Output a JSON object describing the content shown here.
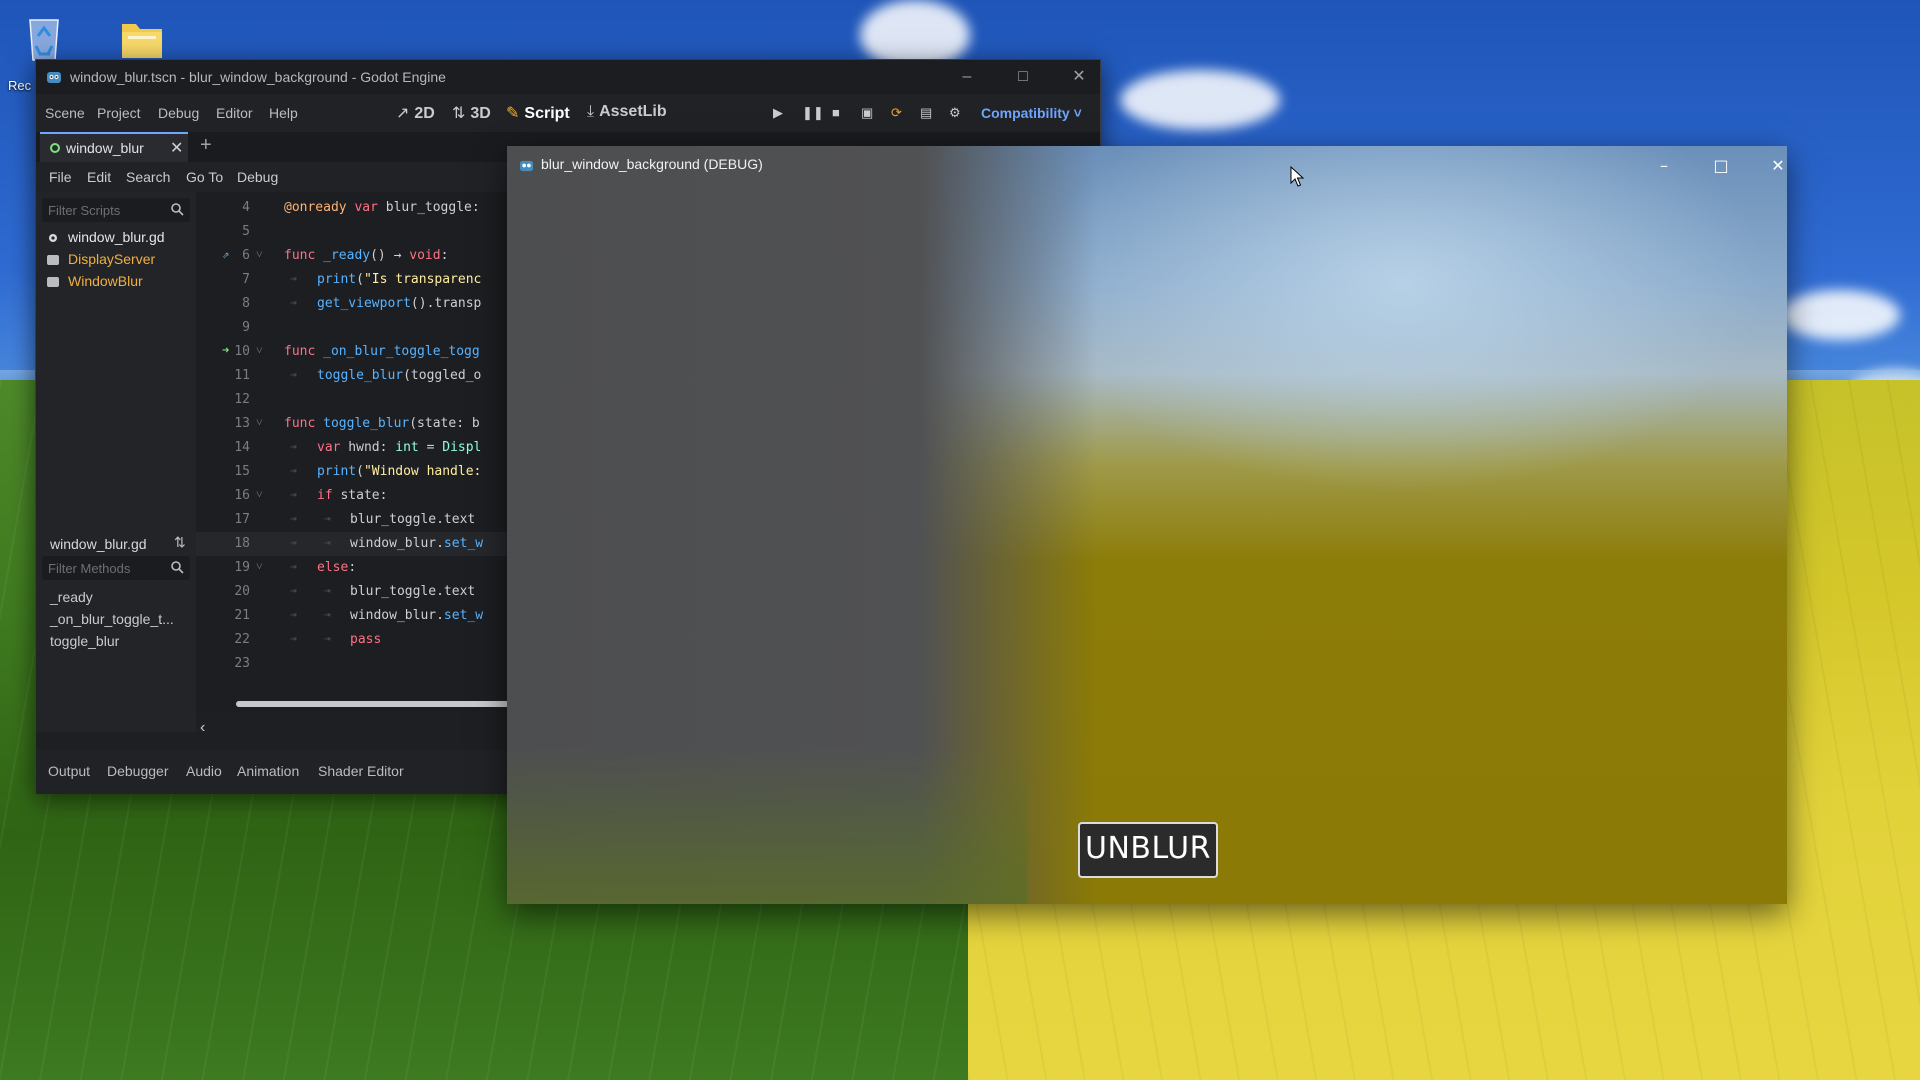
{
  "desktop": {
    "icons": [
      {
        "label": "Rec",
        "icon": "recycle-bin-icon"
      },
      {
        "label": "",
        "icon": "folder-icon"
      }
    ]
  },
  "godot": {
    "title": "window_blur.tscn - blur_window_background - Godot Engine",
    "menus": [
      "Scene",
      "Project",
      "Debug",
      "Editor",
      "Help"
    ],
    "modes": {
      "m2d": "2D",
      "m3d": "3D",
      "script": "Script",
      "assetlib": "AssetLib"
    },
    "renderer": "Compatibility",
    "scene_tab": "window_blur",
    "script_menu": [
      "File",
      "Edit",
      "Search",
      "Go To",
      "Debug"
    ],
    "filter_scripts_placeholder": "Filter Scripts",
    "scripts": [
      "window_blur.gd",
      "DisplayServer",
      "WindowBlur"
    ],
    "methods_title": "window_blur.gd",
    "filter_methods_placeholder": "Filter Methods",
    "methods": [
      "_ready",
      "_on_blur_toggle_t...",
      "toggle_blur"
    ],
    "code": {
      "lines": [
        {
          "n": "4",
          "text": "@onready var blur_toggle:"
        },
        {
          "n": "5",
          "text": ""
        },
        {
          "n": "6",
          "text": "func _ready() → void:"
        },
        {
          "n": "7",
          "text": "print(\"Is transparenc"
        },
        {
          "n": "8",
          "text": "get_viewport().transp"
        },
        {
          "n": "9",
          "text": ""
        },
        {
          "n": "10",
          "text": "func _on_blur_toggle_togg"
        },
        {
          "n": "11",
          "text": "toggle_blur(toggled_o"
        },
        {
          "n": "12",
          "text": ""
        },
        {
          "n": "13",
          "text": "func toggle_blur(state: b"
        },
        {
          "n": "14",
          "text": "var hwnd: int = Displ"
        },
        {
          "n": "15",
          "text": "print(\"Window handle:"
        },
        {
          "n": "16",
          "text": "if state:"
        },
        {
          "n": "17",
          "text": "blur_toggle.text"
        },
        {
          "n": "18",
          "text": "window_blur.set_w"
        },
        {
          "n": "19",
          "text": "else:"
        },
        {
          "n": "20",
          "text": "blur_toggle.text"
        },
        {
          "n": "21",
          "text": "window_blur.set_w"
        },
        {
          "n": "22",
          "text": "pass"
        },
        {
          "n": "23",
          "text": ""
        }
      ]
    },
    "bottom_tabs": [
      "Output",
      "Debugger",
      "Audio",
      "Animation",
      "Shader Editor"
    ]
  },
  "game": {
    "title": "blur_window_background (DEBUG)",
    "button": "UNBLUR"
  },
  "colors": {
    "accent": "#6ea6ff",
    "keyword": "#ff7085",
    "function": "#57b3ff",
    "annotation": "#ffb373",
    "string": "#ffeda1",
    "type": "#8effda",
    "script_item_highlight": "#f0b040"
  }
}
